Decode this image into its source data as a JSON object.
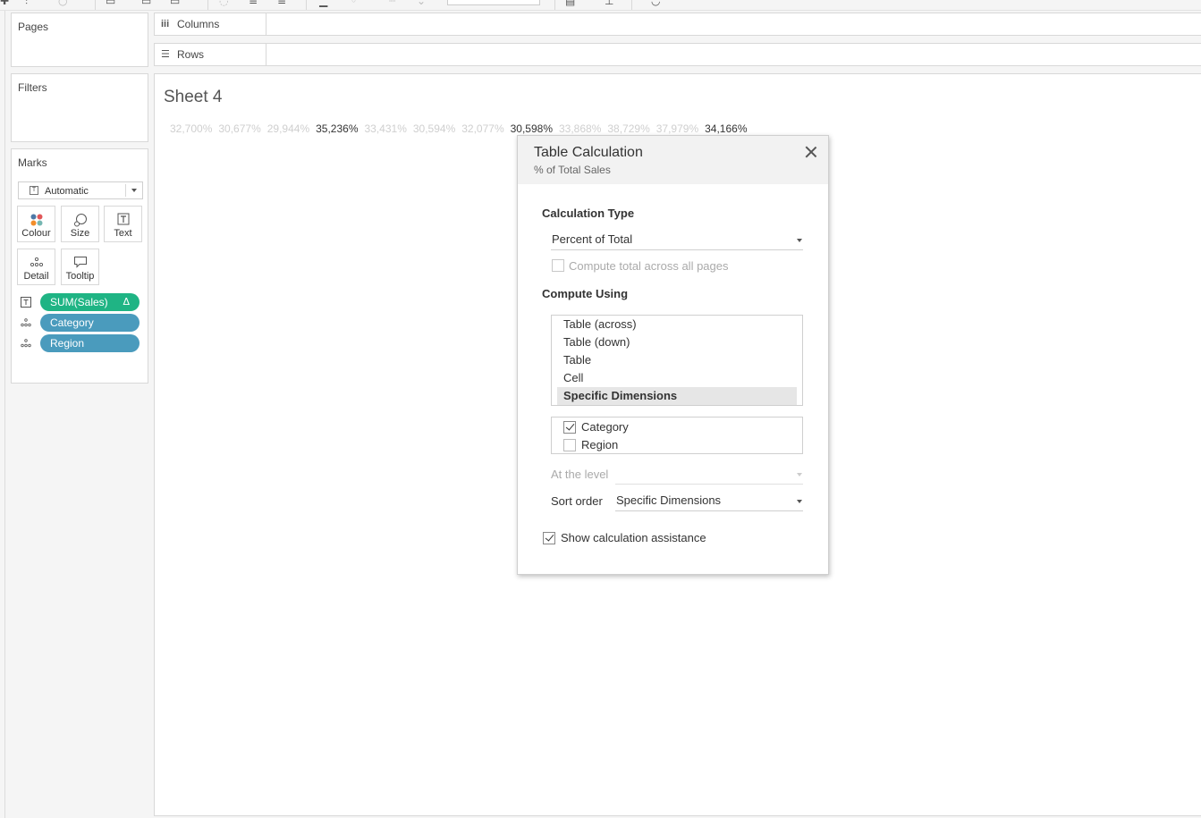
{
  "shelves": {
    "columns_label": "Columns",
    "rows_label": "Rows"
  },
  "cards": {
    "pages_title": "Pages",
    "filters_title": "Filters",
    "marks_title": "Marks"
  },
  "marks": {
    "mark_type": "Automatic",
    "buttons": {
      "colour": "Colour",
      "size": "Size",
      "text": "Text",
      "detail": "Detail",
      "tooltip": "Tooltip"
    },
    "pills": [
      {
        "label": "SUM(Sales)",
        "icon": "text-icon",
        "color": "#1fb484",
        "delta": "Δ"
      },
      {
        "label": "Category",
        "icon": "detail-icon",
        "color": "#4a9bbd"
      },
      {
        "label": "Region",
        "icon": "detail-icon",
        "color": "#4a9bbd"
      }
    ]
  },
  "sheet": {
    "title": "Sheet 4",
    "values": [
      "32,700%",
      "30,677%",
      "29,944%",
      "35,236%",
      "33,431%",
      "30,594%",
      "32,077%",
      "30,598%",
      "33,868%",
      "38,729%",
      "37,979%",
      "34,166%"
    ]
  },
  "dialog": {
    "title": "Table Calculation",
    "subtitle": "% of Total Sales",
    "calc_type_heading": "Calculation Type",
    "calc_type_value": "Percent of Total",
    "compute_total_label": "Compute total across all pages",
    "compute_using_heading": "Compute Using",
    "compute_options": [
      "Table (across)",
      "Table (down)",
      "Table",
      "Cell",
      "Specific Dimensions"
    ],
    "selected_option": "Specific Dimensions",
    "dimensions": [
      {
        "label": "Category",
        "checked": true
      },
      {
        "label": "Region",
        "checked": false
      }
    ],
    "at_level_label": "At the level",
    "at_level_value": "",
    "sort_order_label": "Sort order",
    "sort_order_value": "Specific Dimensions",
    "show_assist_label": "Show calculation assistance"
  },
  "colors": {
    "accent_green": "#1fb484",
    "dimension_blue": "#4a9bbd"
  }
}
